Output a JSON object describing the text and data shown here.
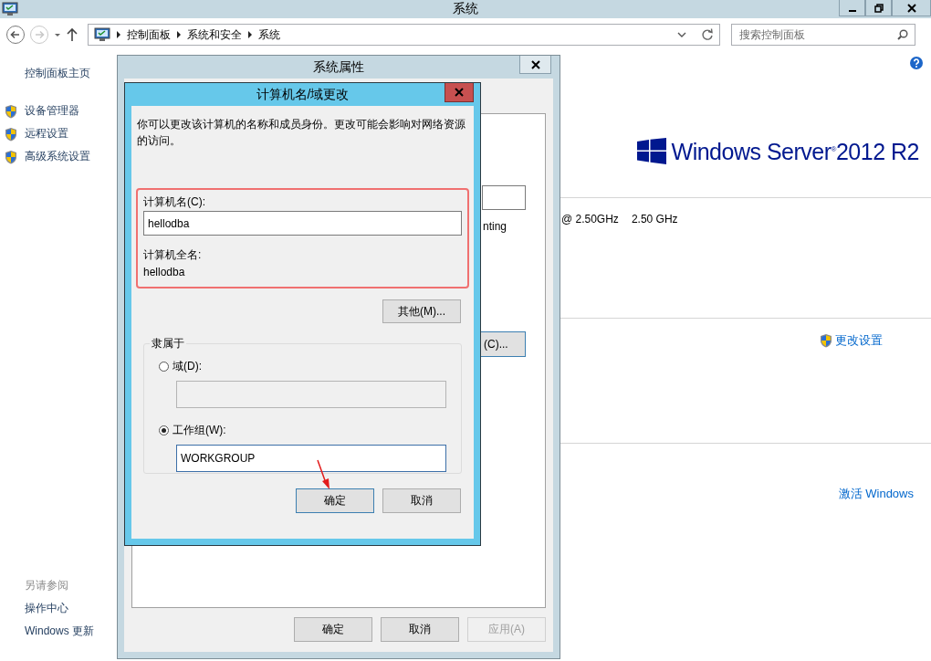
{
  "window": {
    "title": "系统"
  },
  "address_bar": {
    "breadcrumbs": [
      "控制面板",
      "系统和安全",
      "系统"
    ]
  },
  "search": {
    "placeholder": "搜索控制面板"
  },
  "sidebar": {
    "home": "控制面板主页",
    "items": [
      "设备管理器",
      "远程设置",
      "高级系统设置"
    ],
    "see_also_heading": "另请参阅",
    "see_also": [
      "操作中心",
      "Windows 更新"
    ]
  },
  "main": {
    "logo_text": "Windows Server$^{®}$2012 R2",
    "processor_model": "@ 2.50GHz",
    "processor_speed": "2.50 GHz",
    "change_settings": "更改设置",
    "activate": "激活 Windows"
  },
  "system_properties": {
    "title": "系统属性",
    "text_fragment": "nting",
    "button_fragment": "(C)...",
    "buttons": [
      {
        "label": "确定",
        "disabled": false
      },
      {
        "label": "取消",
        "disabled": false
      },
      {
        "label": "应用(A)",
        "disabled": true
      }
    ]
  },
  "name_dialog": {
    "title": "计算机名/域更改",
    "description": "你可以更改该计算机的名称和成员身份。更改可能会影响对网络资源的访问。",
    "computer_name_label": "计算机名(C):",
    "computer_name": "hellodba",
    "full_name_label": "计算机全名:",
    "full_name": "hellodba",
    "more_button": "其他(M)...",
    "member_of": {
      "legend": "隶属于",
      "options": [
        {
          "label": "域(D):",
          "selected": false
        },
        {
          "label": "工作组(W):",
          "selected": true,
          "value": "WORKGROUP"
        }
      ]
    },
    "buttons": [
      {
        "label": "确定",
        "default": true
      },
      {
        "label": "取消",
        "default": false
      }
    ]
  }
}
